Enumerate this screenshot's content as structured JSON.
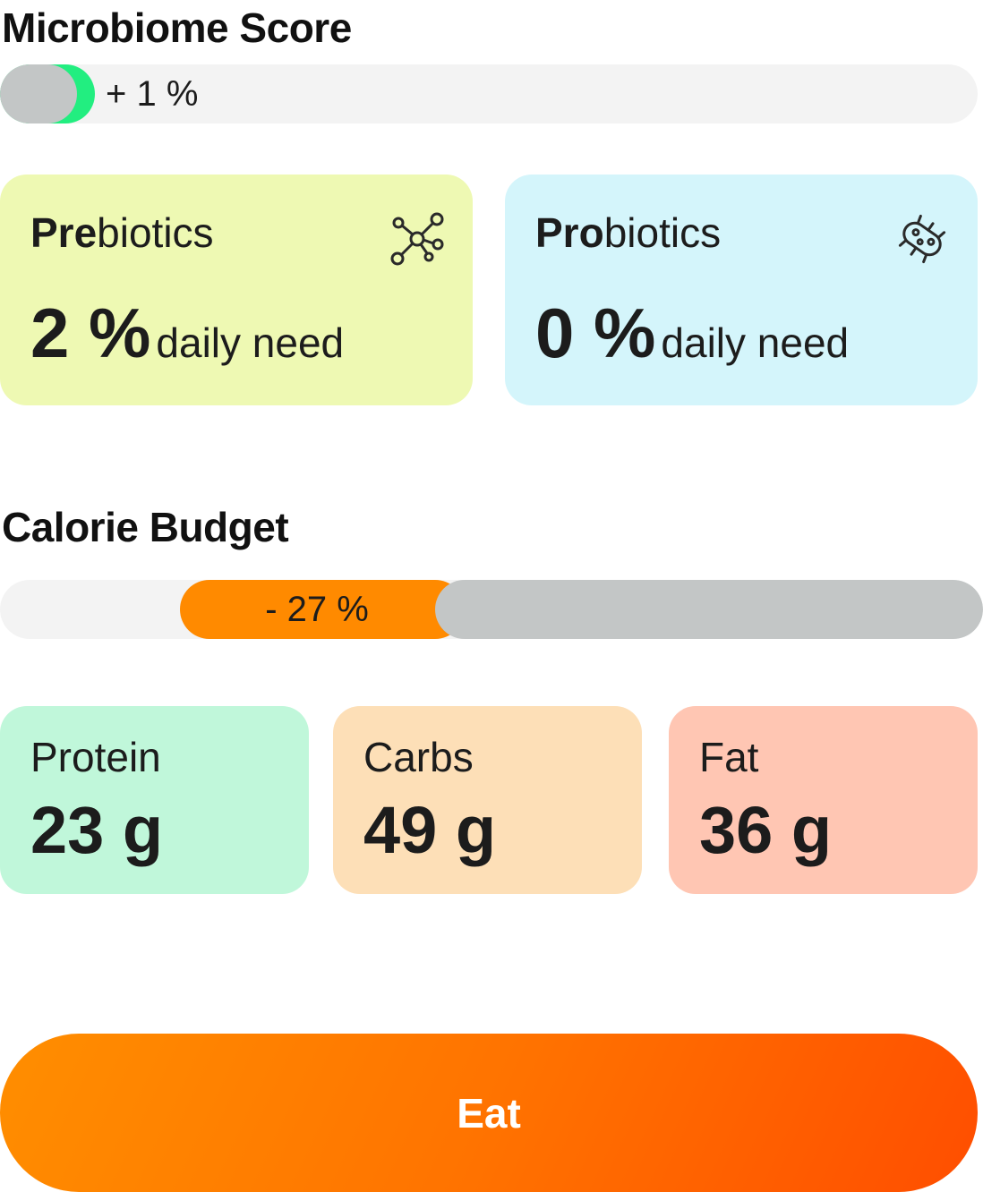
{
  "microbiome": {
    "title": "Microbiome Score",
    "change_label": "+ 1 %"
  },
  "prebiotics": {
    "title_bold": "Pre",
    "title_rest": "biotics",
    "value": "2 %",
    "unit": "daily need",
    "icon": "molecule-icon"
  },
  "probiotics": {
    "title_bold": "Pro",
    "title_rest": "biotics",
    "value": "0 %",
    "unit": "daily need",
    "icon": "bacteria-icon"
  },
  "calorie_budget": {
    "title": "Calorie Budget",
    "change_label": "- 27 %"
  },
  "macros": [
    {
      "name": "Protein",
      "value": "23 g",
      "color": "#c0f7da"
    },
    {
      "name": "Carbs",
      "value": "49 g",
      "color": "#fddfb7"
    },
    {
      "name": "Fat",
      "value": "36 g",
      "color": "#ffc6b3"
    }
  ],
  "eat_button": {
    "label": "Eat"
  },
  "colors": {
    "accent_green": "#22ee80",
    "accent_orange": "#ff8a00",
    "bar_grey": "#c3c6c6",
    "track": "#f3f3f3"
  }
}
